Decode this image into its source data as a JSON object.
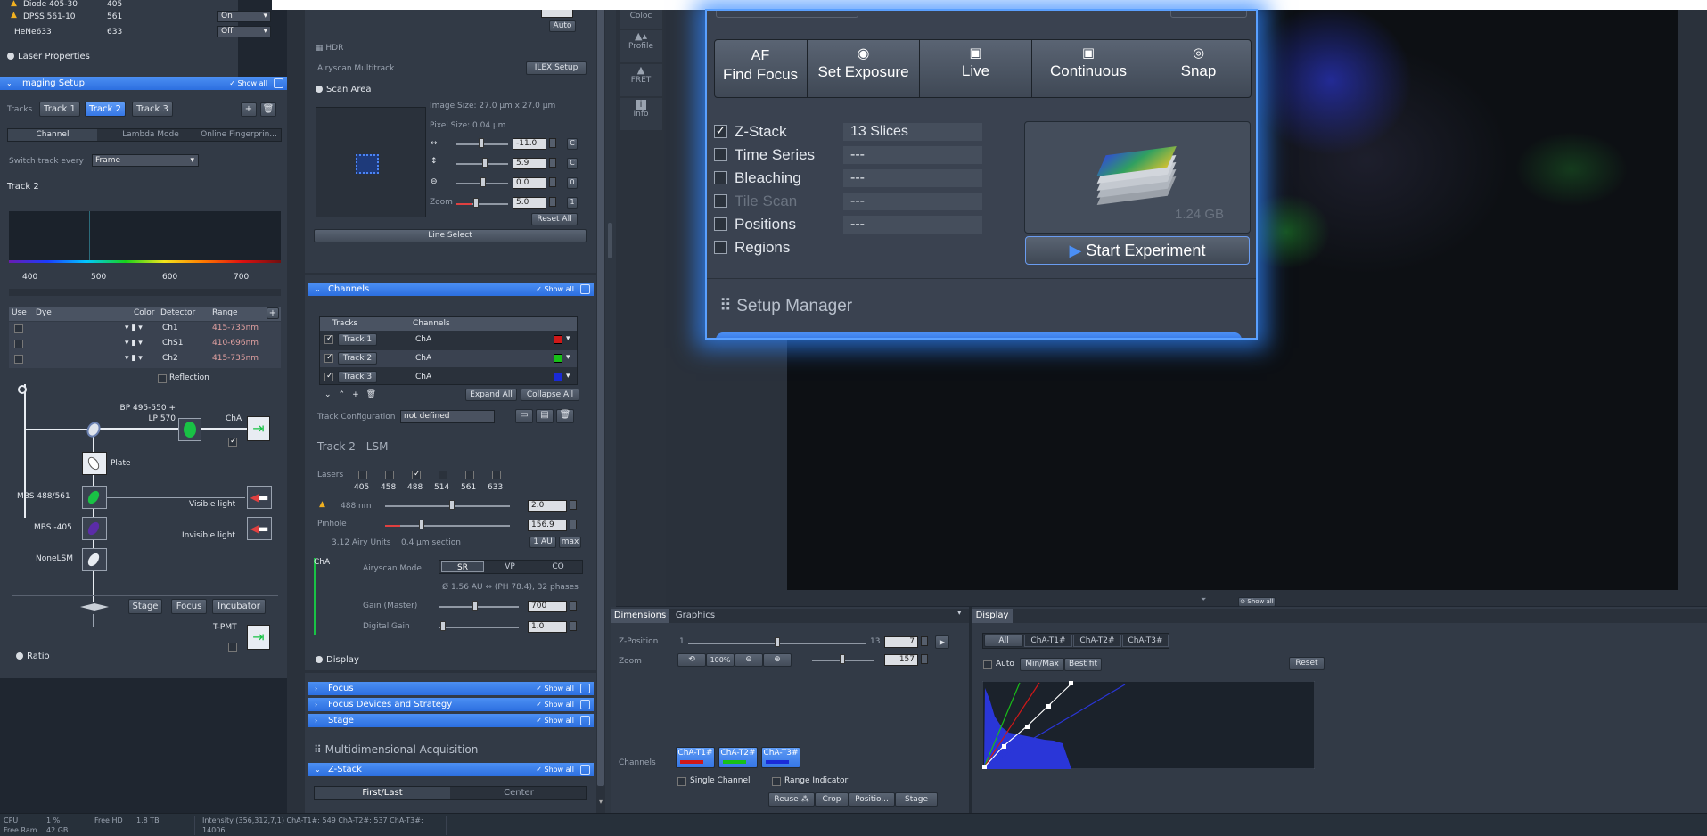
{
  "lasers": [
    {
      "name": "Diode 405-30",
      "wl": "405",
      "state": ""
    },
    {
      "name": "DPSS 561-10",
      "wl": "561",
      "state": "On"
    },
    {
      "name": "HeNe633",
      "wl": "633",
      "state": "Off"
    }
  ],
  "laser_properties": "Laser Properties",
  "imaging": {
    "title": "Imaging Setup",
    "show_all": "✓ Show all",
    "tracks_label": "Tracks",
    "tracks": [
      "Track 1",
      "Track 2",
      "Track 3"
    ],
    "tabs": [
      "Channel",
      "Lambda Mode",
      "Online Fingerprin..."
    ],
    "switch_label": "Switch track every",
    "switch_value": "Frame",
    "track_title": "Track 2",
    "spectrum_ticks": [
      "400",
      "500",
      "600",
      "700"
    ],
    "table_headers": [
      "Use",
      "Dye",
      "Color",
      "Detector",
      "Range"
    ],
    "rows": [
      {
        "det": "Ch1",
        "range": "415-735nm"
      },
      {
        "det": "ChS1",
        "range": "410-696nm"
      },
      {
        "det": "Ch2",
        "range": "415-735nm"
      }
    ],
    "reflection": "Reflection",
    "filter_label": "BP 495-550 + LP 570",
    "cha": "ChA",
    "plate": "Plate",
    "mbs1": "MBS 488/561",
    "mbs2": "MBS -405",
    "mbs3": "NoneLSM",
    "visible": "Visible light",
    "invisible": "Invisible light",
    "stage": "Stage",
    "focus": "Focus",
    "incubator": "Incubator",
    "tpmt": "T-PMT"
  },
  "ratio": "Ratio",
  "middle": {
    "auto": "Auto",
    "hdr": "HDR",
    "airyscan_mt": "Airyscan Multitrack",
    "ilex": "ILEX Setup",
    "scan_area": "Scan Area",
    "image_size": "Image Size:  27.0 µm x 27.0 µm",
    "pixel_size": "Pixel Size:   0.04 µm",
    "offset_x": "-11.0",
    "offset_y": "5.9",
    "rotation": "0.0",
    "zoom_label": "Zoom",
    "zoom": "5.0",
    "reset_all": "Reset All",
    "line_select": "Line Select",
    "channels_title": "Channels",
    "show_all": "✓ Show all",
    "ch_headers": [
      "Tracks",
      "Channels"
    ],
    "ch_rows": [
      {
        "track": "Track 1",
        "ch": "ChA",
        "color": "#d01818"
      },
      {
        "track": "Track 2",
        "ch": "ChA",
        "color": "#18c018"
      },
      {
        "track": "Track 3",
        "ch": "ChA",
        "color": "#1a2ad8"
      }
    ],
    "expand_all": "Expand All",
    "collapse_all": "Collapse All",
    "track_config": "Track Configuration",
    "track_config_value": "not defined",
    "track_lsm": "Track 2 - LSM",
    "lasers_label": "Lasers",
    "laser_lines": [
      "405",
      "458",
      "488",
      "514",
      "561",
      "633"
    ],
    "laser_488": "488 nm",
    "laser_488_val": "2.0",
    "pinhole": "Pinhole",
    "pinhole_val": "156.9",
    "airy_units": "3.12 Airy Units",
    "section": "0.4 µm section",
    "one_au": "1 AU",
    "max": "max",
    "cha": "ChA",
    "airyscan_mode": "Airyscan Mode",
    "modes": [
      "SR",
      "VP",
      "CO"
    ],
    "airy_info": "Ø 1.56 AU ⇔ (PH 78.4), 32 phases",
    "gain_master": "Gain (Master)",
    "gain_val": "700",
    "digital_gain": "Digital Gain",
    "digital_val": "1.0",
    "display": "Display",
    "focus": "Focus",
    "focus_devices": "Focus Devices and Strategy",
    "stage": "Stage",
    "mda": "Multidimensional Acquisition",
    "zstack": "Z-Stack",
    "first_last": "First/Last",
    "center": "Center"
  },
  "sidetools": [
    "Coloc",
    "Profile",
    "FRET",
    "Info"
  ],
  "experiment": {
    "buttons": [
      "AF",
      "Set Exposure",
      "Live",
      "Continuous",
      "Snap"
    ],
    "af_sub": "Find Focus",
    "options": [
      {
        "label": "Z-Stack",
        "value": "13 Slices",
        "checked": true
      },
      {
        "label": "Time Series",
        "value": "---"
      },
      {
        "label": "Bleaching",
        "value": "---"
      },
      {
        "label": "Tile Scan",
        "value": "---"
      },
      {
        "label": "Positions",
        "value": "---"
      },
      {
        "label": "Regions",
        "value": ""
      }
    ],
    "size": "1.24 GB",
    "start": "Start Experiment",
    "setup_manager": "Setup Manager"
  },
  "viewer": {
    "show_all": "Show all"
  },
  "dimensions": {
    "tabs": [
      "Dimensions",
      "Graphics"
    ],
    "zpos_label": "Z-Position",
    "zmin": "1",
    "zmax": "13",
    "zval": "7",
    "zoom_label": "Zoom",
    "zoom_pct": "100%",
    "zoom_val": "157",
    "channels_label": "Channels",
    "channels": [
      "ChA-T1#",
      "ChA-T2#",
      "ChA-T3#"
    ],
    "single_channel": "Single Channel",
    "range_indicator": "Range Indicator",
    "buttons": [
      "Reuse",
      "Crop",
      "Positio...",
      "Stage"
    ]
  },
  "display": {
    "title": "Display",
    "tabs": [
      "All",
      "ChA-T1#",
      "ChA-T2#",
      "ChA-T3#"
    ],
    "auto": "Auto",
    "minmax": "Min/Max",
    "bestfit": "Best fit",
    "reset": "Reset"
  },
  "status": {
    "cpu_label": "CPU",
    "cpu": "1 %",
    "freehd_label": "Free HD",
    "freehd": "1.8 TB",
    "freeram_label": "Free Ram",
    "freeram": "42 GB",
    "intensity": "Intensity (356,312,7,1) ChA-T1#: 549 ChA-T2#: 537 ChA-T3#:",
    "intensity2": "14006"
  },
  "colors": {
    "accent": "#3a7ef0",
    "glow": "#2f86ff"
  }
}
